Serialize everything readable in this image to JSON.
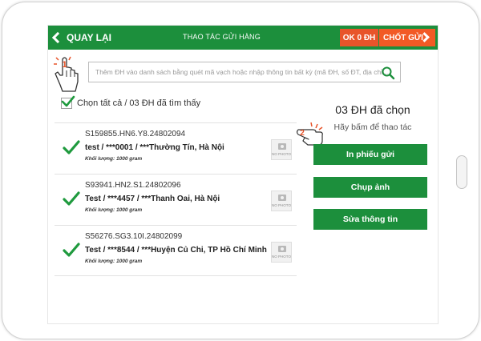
{
  "header": {
    "back_label": "QUAY LẠI",
    "title": "THAO TÁC GỬI HÀNG",
    "ok_badge": "OK 0 ĐH",
    "confirm_label": "CHỐT GỬI"
  },
  "search": {
    "placeholder": "Thêm ĐH vào danh sách bằng quét mã vạch hoặc nhập thông tin bất kỳ (mã ĐH, số ĐT, địa chỉ,..."
  },
  "select_all": {
    "label": "Chọn tất cả / 03 ĐH đã tìm thấy"
  },
  "orders": [
    {
      "code": "S159855.HN6.Y8.24802094",
      "info": "test / ***0001 / ***Thường Tín, Hà Nội",
      "weight": "Khối lượng: 1000 gram",
      "photo_label": "NO PHOTO"
    },
    {
      "code": "S93941.HN2.S1.24802096",
      "info": "Test / ***4457 / ***Thanh Oai, Hà Nội",
      "weight": "Khối lượng: 1000 gram",
      "photo_label": "NO PHOTO"
    },
    {
      "code": "S56276.SG3.10I.24802099",
      "info": "Test / ***8544 / ***Huyện Củ Chi, TP Hồ Chí Minh",
      "weight": "Khối lượng: 1000 gram",
      "photo_label": "NO PHOTO"
    }
  ],
  "panel": {
    "selected_title": "03 ĐH đã chọn",
    "hint": "Hãy bấm để thao tác",
    "actions": [
      "In phiếu gửi",
      "Chụp ảnh",
      "Sửa thông tin"
    ]
  },
  "tutorial_steps": [
    "1",
    "2"
  ],
  "icons": {
    "back": "chevron-left-icon",
    "forward": "chevron-right-icon",
    "search": "magnifier-icon",
    "check": "checkmark-icon",
    "camera": "camera-icon",
    "pointer": "hand-pointer-icon"
  },
  "colors": {
    "brand_green": "#1c8f3c",
    "accent_orange": "#f25a25",
    "check_green": "#1f9a3e"
  }
}
